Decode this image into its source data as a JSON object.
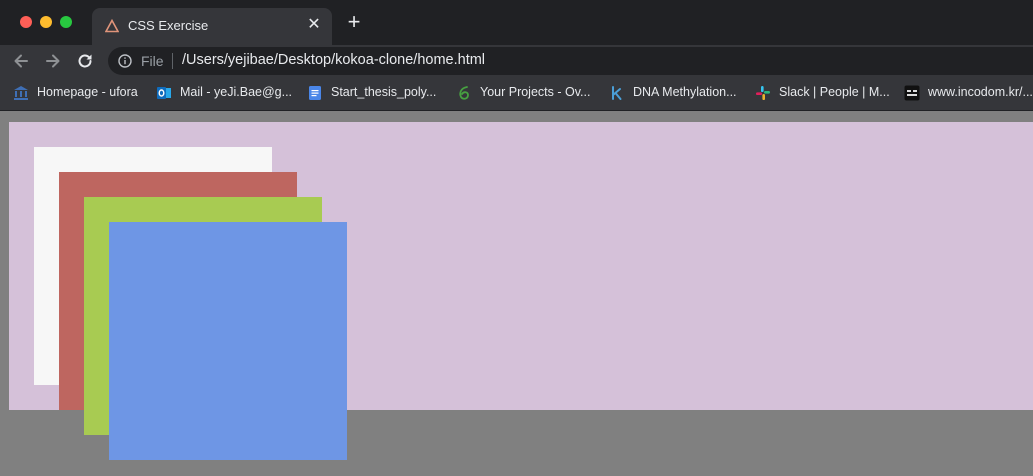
{
  "window": {
    "controls": [
      "close",
      "minimize",
      "maximize"
    ]
  },
  "tab": {
    "title": "CSS Exercise",
    "icon": "triangle-favicon"
  },
  "toolbar": {
    "scheme": "File",
    "url": "/Users/yejibae/Desktop/kokoa-clone/home.html"
  },
  "bookmarks": [
    {
      "label": "Homepage - ufora",
      "icon": "university-icon"
    },
    {
      "label": "Mail - yeJi.Bae@g...",
      "icon": "outlook-icon"
    },
    {
      "label": "Start_thesis_poly...",
      "icon": "google-docs-icon"
    },
    {
      "label": "Your Projects - Ov...",
      "icon": "overleaf-icon"
    },
    {
      "label": "DNA Methylation...",
      "icon": "k-icon"
    },
    {
      "label": "Slack | People | M...",
      "icon": "slack-icon"
    },
    {
      "label": "www.incodom.kr/...",
      "icon": "incodom-icon"
    }
  ],
  "page": {
    "background": "#d5c1d9",
    "squares": [
      {
        "color": "#f7f7f7"
      },
      {
        "color": "#be6660"
      },
      {
        "color": "#a8cb52"
      },
      {
        "color": "#6e96e5"
      }
    ]
  }
}
